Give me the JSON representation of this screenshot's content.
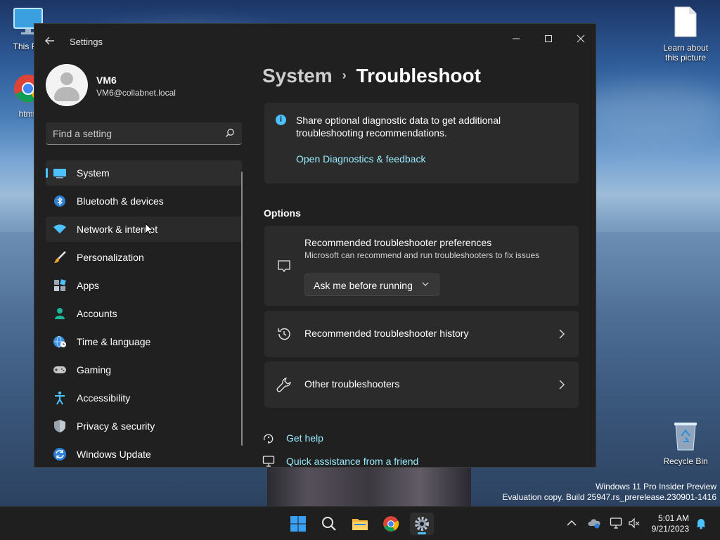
{
  "desktop": {
    "icons": {
      "this_pc": "This PC",
      "chrome": "htmft",
      "learn": "Learn about this picture",
      "recycle": "Recycle Bin"
    },
    "watermark": {
      "line1": "Windows 11 Pro Insider Preview",
      "line2": "Evaluation copy. Build 25947.rs_prerelease.230901-1416"
    }
  },
  "window": {
    "title": "Settings",
    "controls": {
      "minimize": "—",
      "maximize": "☐",
      "close": "✕"
    }
  },
  "profile": {
    "name": "VM6",
    "email": "VM6@collabnet.local"
  },
  "search": {
    "placeholder": "Find a setting"
  },
  "nav": {
    "items": [
      {
        "label": "System",
        "icon": "system-icon"
      },
      {
        "label": "Bluetooth & devices",
        "icon": "bluetooth-icon"
      },
      {
        "label": "Network & internet",
        "icon": "wifi-icon"
      },
      {
        "label": "Personalization",
        "icon": "brush-icon"
      },
      {
        "label": "Apps",
        "icon": "apps-icon"
      },
      {
        "label": "Accounts",
        "icon": "person-icon"
      },
      {
        "label": "Time & language",
        "icon": "globe-clock-icon"
      },
      {
        "label": "Gaming",
        "icon": "gamepad-icon"
      },
      {
        "label": "Accessibility",
        "icon": "accessibility-icon"
      },
      {
        "label": "Privacy & security",
        "icon": "shield-icon"
      },
      {
        "label": "Windows Update",
        "icon": "update-icon"
      }
    ],
    "selected": "System"
  },
  "breadcrumb": {
    "parent": "System",
    "separator": "›",
    "current": "Troubleshoot"
  },
  "info_card": {
    "text": "Share optional diagnostic data to get additional troubleshooting recommendations.",
    "link": "Open Diagnostics & feedback"
  },
  "options": {
    "title": "Options",
    "preferences": {
      "title": "Recommended troubleshooter preferences",
      "description": "Microsoft can recommend and run troubleshooters to fix issues",
      "selected": "Ask me before running"
    },
    "history": {
      "label": "Recommended troubleshooter history"
    },
    "other": {
      "label": "Other troubleshooters"
    }
  },
  "help": {
    "get_help": "Get help",
    "quick_assist": "Quick assistance from a friend"
  },
  "taskbar": {
    "time": "5:01 AM",
    "date": "9/21/2023"
  },
  "colors": {
    "accent": "#4cc2ff",
    "link": "#99ebff",
    "window_bg": "#202020",
    "card_bg": "#2b2b2b"
  }
}
